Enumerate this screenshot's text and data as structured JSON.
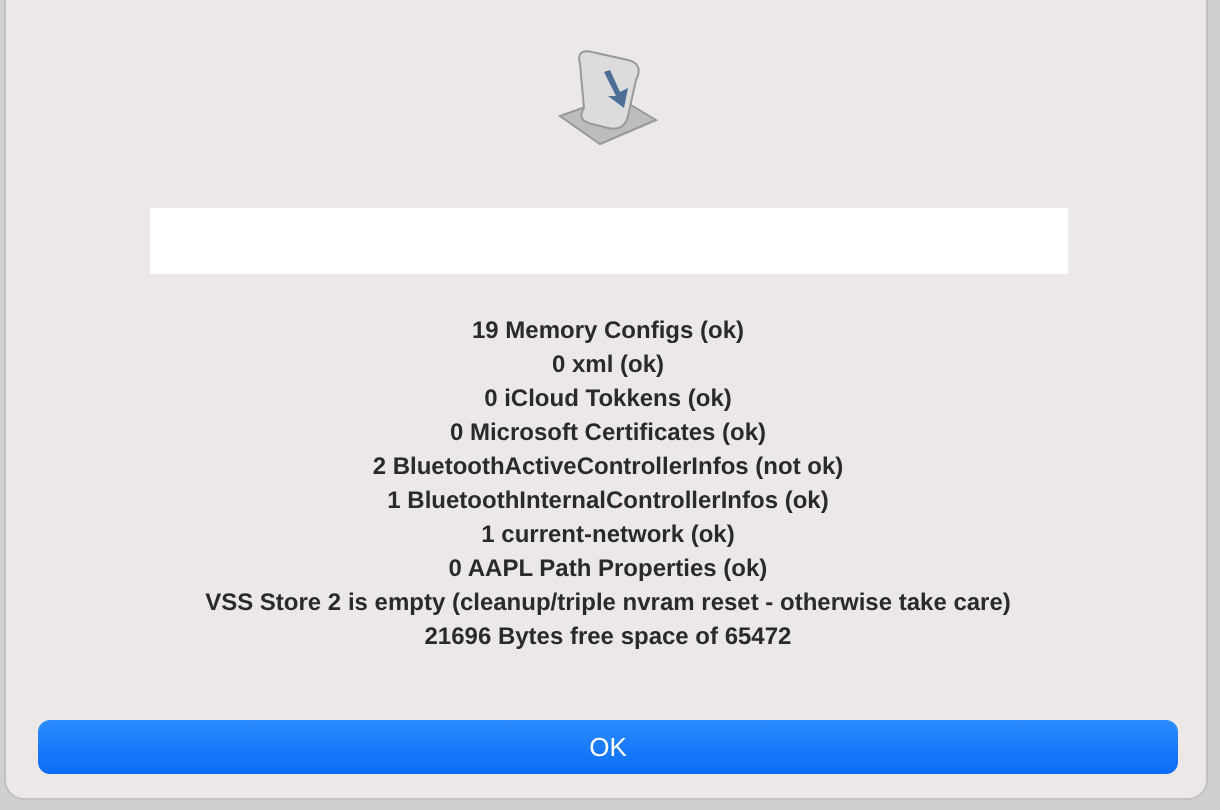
{
  "message_lines": [
    "19 Memory Configs (ok)",
    "0 xml (ok)",
    "0 iCloud Tokkens (ok)",
    "0 Microsoft Certificates (ok)",
    "2 BluetoothActiveControllerInfos (not ok)",
    "1 BluetoothInternalControllerInfos (ok)",
    "1 current-network (ok)",
    "0 AAPL Path Properties (ok)",
    "VSS Store 2 is empty (cleanup/triple nvram reset - otherwise take care)",
    "21696 Bytes free space of 65472"
  ],
  "buttons": [
    {
      "label": "OK"
    }
  ]
}
